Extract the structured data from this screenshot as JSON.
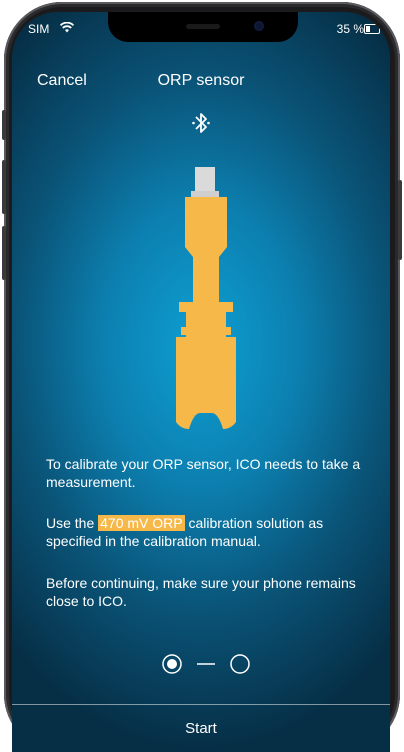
{
  "status_bar": {
    "carrier": "SIM",
    "wifi_icon": "wifi-icon",
    "battery_percent": "35 %",
    "battery_level": 0.35
  },
  "nav": {
    "cancel_label": "Cancel",
    "title": "ORP sensor"
  },
  "icons": {
    "bluetooth": "bluetooth-icon",
    "sensor": "orp-sensor-illustration"
  },
  "colors": {
    "accent": "#f7b84a",
    "background_center": "#0e9fd3",
    "background_edge": "#062e45",
    "text": "#ffffff"
  },
  "body": {
    "p1": "To calibrate your ORP sensor, ICO needs to take a measurement.",
    "p2_before": "Use the ",
    "p2_highlight": "470 mV ORP",
    "p2_after": " calibration solution as specified in the calibration manual.",
    "p3": "Before continuing, make sure your phone remains close to ICO."
  },
  "stepper": {
    "current_step": 1,
    "total_steps": 2
  },
  "footer": {
    "start_label": "Start"
  }
}
